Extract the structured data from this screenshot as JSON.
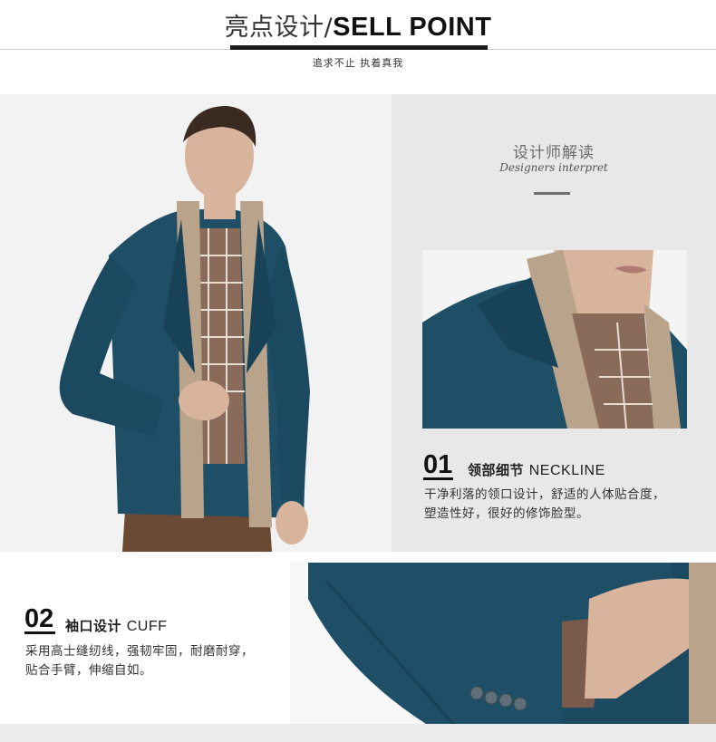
{
  "header": {
    "title_cn": "亮点设计/",
    "title_en": "SELL POINT",
    "subtitle": "追求不止 执着真我"
  },
  "designer": {
    "title_cn": "设计师解读",
    "title_en": "Designers interpret"
  },
  "features": [
    {
      "number": "01",
      "title_cn": "领部细节",
      "title_en": "NECKLINE",
      "desc_line1": "干净利落的领口设计，舒适的人体贴合度，",
      "desc_line2": "塑造性好，很好的修饰脸型。"
    },
    {
      "number": "02",
      "title_cn": "袖口设计",
      "title_en": "CUFF",
      "desc_line1": "采用高士缝纫线，强韧牢固，耐磨耐穿，",
      "desc_line2": "贴合手臂，伸缩自如。"
    }
  ],
  "colors": {
    "jacket": "#1f4f66",
    "scarf": "#b9a38a",
    "shirt": "#8a6a58",
    "trousers": "#6b4a35",
    "skin": "#d9b49c"
  }
}
